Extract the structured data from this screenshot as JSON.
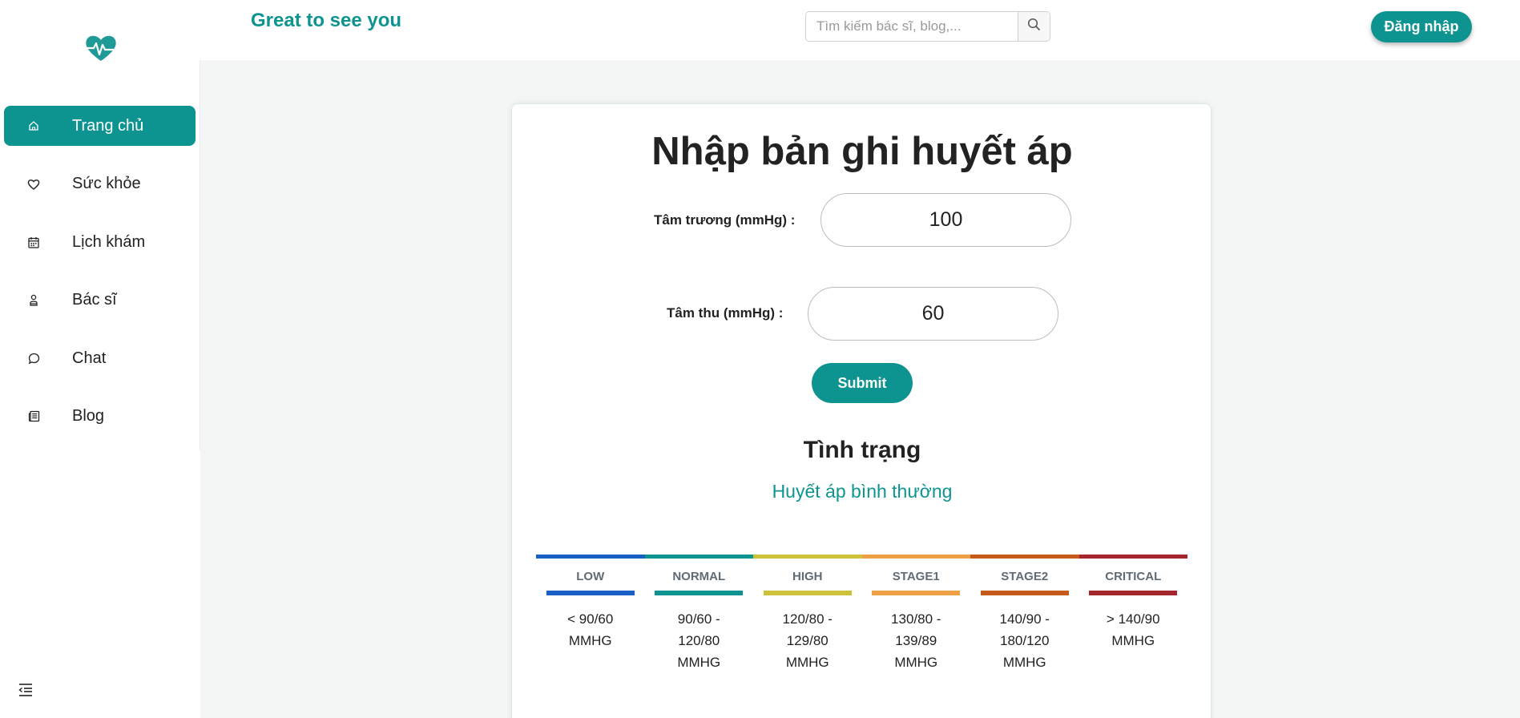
{
  "header": {
    "greeting": "Great to see you",
    "search_placeholder": "Tìm kiếm bác sĩ, blog,...",
    "login_label": "Đăng nhập"
  },
  "sidebar": {
    "items": [
      {
        "label": "Trang chủ",
        "icon": "home-icon",
        "active": true
      },
      {
        "label": "Sức khỏe",
        "icon": "heart-icon",
        "active": false
      },
      {
        "label": "Lịch khám",
        "icon": "calendar-icon",
        "active": false
      },
      {
        "label": "Bác sĩ",
        "icon": "doctor-icon",
        "active": false
      },
      {
        "label": "Chat",
        "icon": "chat-icon",
        "active": false
      },
      {
        "label": "Blog",
        "icon": "newspaper-icon",
        "active": false
      }
    ]
  },
  "form": {
    "title": "Nhập bản ghi huyết áp",
    "diastolic_label": "Tâm trương (mmHg) :",
    "diastolic_value": "100",
    "systolic_label": "Tâm thu (mmHg) :",
    "systolic_value": "60",
    "submit_label": "Submit"
  },
  "status": {
    "heading": "Tình trạng",
    "value": "Huyết áp bình thường"
  },
  "scale": [
    {
      "name": "LOW",
      "line1": "< 90/60",
      "line2": "MMHG",
      "line3": "",
      "color": "#1a5fc8"
    },
    {
      "name": "NORMAL",
      "line1": "90/60 -",
      "line2": "120/80",
      "line3": "MMHG",
      "color": "#0e9490"
    },
    {
      "name": "HIGH",
      "line1": "120/80 -",
      "line2": "129/80",
      "line3": "MMHG",
      "color": "#cdc23a"
    },
    {
      "name": "STAGE1",
      "line1": "130/80 -",
      "line2": "139/89",
      "line3": "MMHG",
      "color": "#eda045"
    },
    {
      "name": "STAGE2",
      "line1": "140/90 -",
      "line2": "180/120",
      "line3": "MMHG",
      "color": "#c65a1a"
    },
    {
      "name": "CRITICAL",
      "line1": "> 140/90",
      "line2": "MMHG",
      "line3": "",
      "color": "#a4262c"
    }
  ],
  "colors": {
    "accent": "#0e9490",
    "background": "#f4f5f5"
  }
}
